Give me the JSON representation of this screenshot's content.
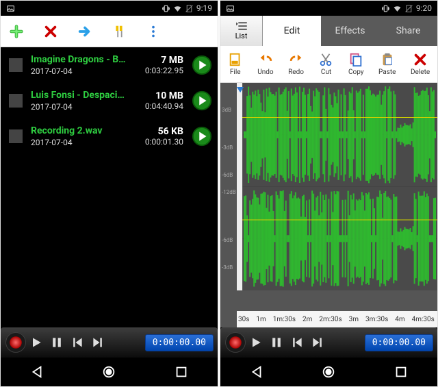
{
  "left": {
    "statusbar": {
      "time": "9:19"
    },
    "tracks": [
      {
        "title": "Imagine Dragons - Believe…",
        "date": "2017-07-04",
        "size": "7 MB",
        "dur": "0:03:22.95"
      },
      {
        "title": "Luis Fonsi - Despacito ft. …",
        "date": "2017-07-04",
        "size": "10 MB",
        "dur": "0:04:40.94"
      },
      {
        "title": "Recording 2.wav",
        "date": "2017-07-04",
        "size": "56 KB",
        "dur": "0:00:01.30"
      }
    ],
    "counter": "0:00:00.00"
  },
  "right": {
    "statusbar": {
      "time": "9:20"
    },
    "list_btn": "List",
    "tabs": [
      {
        "label": "Edit",
        "active": true
      },
      {
        "label": "Effects",
        "active": false
      },
      {
        "label": "Share",
        "active": false
      }
    ],
    "toolbar": [
      {
        "k": "file",
        "label": "File"
      },
      {
        "k": "undo",
        "label": "Undo"
      },
      {
        "k": "redo",
        "label": "Redo"
      },
      {
        "k": "cut",
        "label": "Cut"
      },
      {
        "k": "copy",
        "label": "Copy"
      },
      {
        "k": "paste",
        "label": "Paste"
      },
      {
        "k": "delete",
        "label": "Delete"
      }
    ],
    "db_labels": [
      "3dB",
      "-3dB",
      "-6dB",
      "-12dB",
      "-6dB",
      "-3dB"
    ],
    "time_ticks": [
      "30s",
      "1m",
      "1m:30s",
      "2m",
      "2m:30s",
      "3m",
      "3m:30s",
      "4m",
      "4m:30s"
    ],
    "counter": "0:00:00.00"
  }
}
